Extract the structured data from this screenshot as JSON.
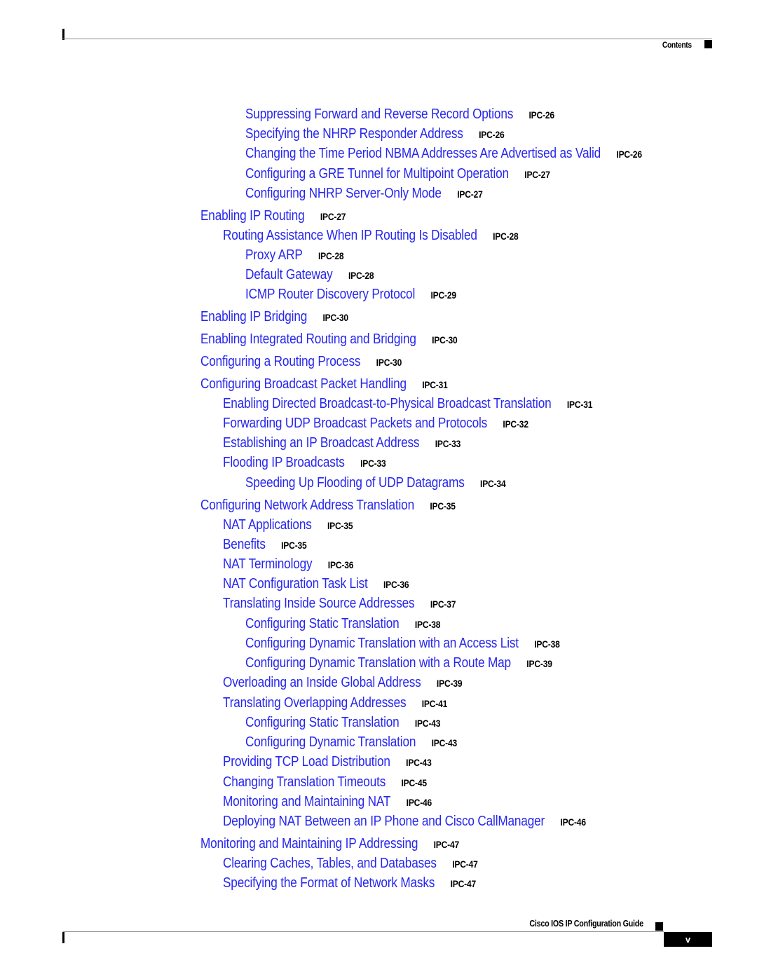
{
  "header": {
    "section_label": "Contents"
  },
  "toc": [
    {
      "level": 3,
      "title": "Suppressing Forward and Reverse Record Options",
      "page": "IPC-26"
    },
    {
      "level": 3,
      "title": "Specifying the NHRP Responder Address",
      "page": "IPC-26"
    },
    {
      "level": 3,
      "title": "Changing the Time Period NBMA Addresses Are Advertised as Valid",
      "page": "IPC-26"
    },
    {
      "level": 3,
      "title": "Configuring a GRE Tunnel for Multipoint Operation",
      "page": "IPC-27"
    },
    {
      "level": 3,
      "title": "Configuring NHRP Server-Only Mode",
      "page": "IPC-27"
    },
    {
      "level": 1,
      "title": "Enabling IP Routing",
      "page": "IPC-27"
    },
    {
      "level": 2,
      "title": "Routing Assistance When IP Routing Is Disabled",
      "page": "IPC-28"
    },
    {
      "level": 3,
      "title": "Proxy ARP",
      "page": "IPC-28"
    },
    {
      "level": 3,
      "title": "Default Gateway",
      "page": "IPC-28"
    },
    {
      "level": 3,
      "title": "ICMP Router Discovery Protocol",
      "page": "IPC-29"
    },
    {
      "level": 1,
      "title": "Enabling IP Bridging",
      "page": "IPC-30"
    },
    {
      "level": 1,
      "title": "Enabling Integrated Routing and Bridging",
      "page": "IPC-30"
    },
    {
      "level": 1,
      "title": "Configuring a Routing Process",
      "page": "IPC-30"
    },
    {
      "level": 1,
      "title": "Configuring Broadcast Packet Handling",
      "page": "IPC-31"
    },
    {
      "level": 2,
      "title": "Enabling Directed Broadcast-to-Physical Broadcast Translation",
      "page": "IPC-31"
    },
    {
      "level": 2,
      "title": "Forwarding UDP Broadcast Packets and Protocols",
      "page": "IPC-32"
    },
    {
      "level": 2,
      "title": "Establishing an IP Broadcast Address",
      "page": "IPC-33"
    },
    {
      "level": 2,
      "title": "Flooding IP Broadcasts",
      "page": "IPC-33"
    },
    {
      "level": 3,
      "title": "Speeding Up Flooding of UDP Datagrams",
      "page": "IPC-34"
    },
    {
      "level": 1,
      "title": "Configuring Network Address Translation",
      "page": "IPC-35"
    },
    {
      "level": 2,
      "title": "NAT Applications",
      "page": "IPC-35"
    },
    {
      "level": 2,
      "title": "Benefits",
      "page": "IPC-35"
    },
    {
      "level": 2,
      "title": "NAT Terminology",
      "page": "IPC-36"
    },
    {
      "level": 2,
      "title": "NAT Configuration Task List",
      "page": "IPC-36"
    },
    {
      "level": 2,
      "title": "Translating Inside Source Addresses",
      "page": "IPC-37"
    },
    {
      "level": 3,
      "title": "Configuring Static Translation",
      "page": "IPC-38"
    },
    {
      "level": 3,
      "title": "Configuring Dynamic Translation with an Access List",
      "page": "IPC-38"
    },
    {
      "level": 3,
      "title": "Configuring Dynamic Translation with a Route Map",
      "page": "IPC-39"
    },
    {
      "level": 2,
      "title": "Overloading an Inside Global Address",
      "page": "IPC-39"
    },
    {
      "level": 2,
      "title": "Translating Overlapping Addresses",
      "page": "IPC-41"
    },
    {
      "level": 3,
      "title": "Configuring Static Translation",
      "page": "IPC-43"
    },
    {
      "level": 3,
      "title": "Configuring Dynamic Translation",
      "page": "IPC-43"
    },
    {
      "level": 2,
      "title": "Providing TCP Load Distribution",
      "page": "IPC-43"
    },
    {
      "level": 2,
      "title": "Changing Translation Timeouts",
      "page": "IPC-45"
    },
    {
      "level": 2,
      "title": "Monitoring and Maintaining NAT",
      "page": "IPC-46"
    },
    {
      "level": 2,
      "title": "Deploying NAT Between an IP Phone and Cisco CallManager",
      "page": "IPC-46"
    },
    {
      "level": 1,
      "title": "Monitoring and Maintaining IP Addressing",
      "page": "IPC-47"
    },
    {
      "level": 2,
      "title": "Clearing Caches, Tables, and Databases",
      "page": "IPC-47"
    },
    {
      "level": 2,
      "title": "Specifying the Format of Network Masks",
      "page": "IPC-47"
    }
  ],
  "footer": {
    "book_title": "Cisco IOS IP Configuration Guide",
    "page_number": "v"
  },
  "colors": {
    "link": "#2626f0",
    "page_ref": "#000000"
  }
}
